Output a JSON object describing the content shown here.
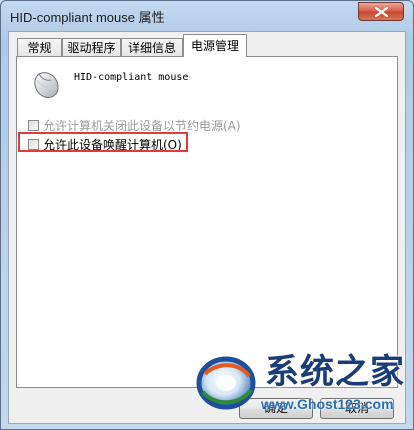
{
  "window": {
    "title": "HID-compliant mouse 属性"
  },
  "tabs": [
    {
      "label": "常规"
    },
    {
      "label": "驱动程序"
    },
    {
      "label": "详细信息"
    },
    {
      "label": "电源管理",
      "active": true
    }
  ],
  "device": {
    "icon": "mouse-icon",
    "name": "HID-compliant mouse"
  },
  "options": {
    "allow_power_off": {
      "label": "允许计算机关闭此设备以节约电源(A)",
      "checked": false,
      "enabled": false
    },
    "allow_wake": {
      "label": "允许此设备唤醒计算机(O)",
      "checked": false,
      "enabled": true
    }
  },
  "buttons": {
    "ok": "确定",
    "cancel": "取消"
  },
  "watermark": {
    "title": "系统之家",
    "url": "www.Ghost123.com"
  },
  "colors": {
    "highlight": "#e03a3a",
    "watermark_text": "#1a3d7a"
  }
}
